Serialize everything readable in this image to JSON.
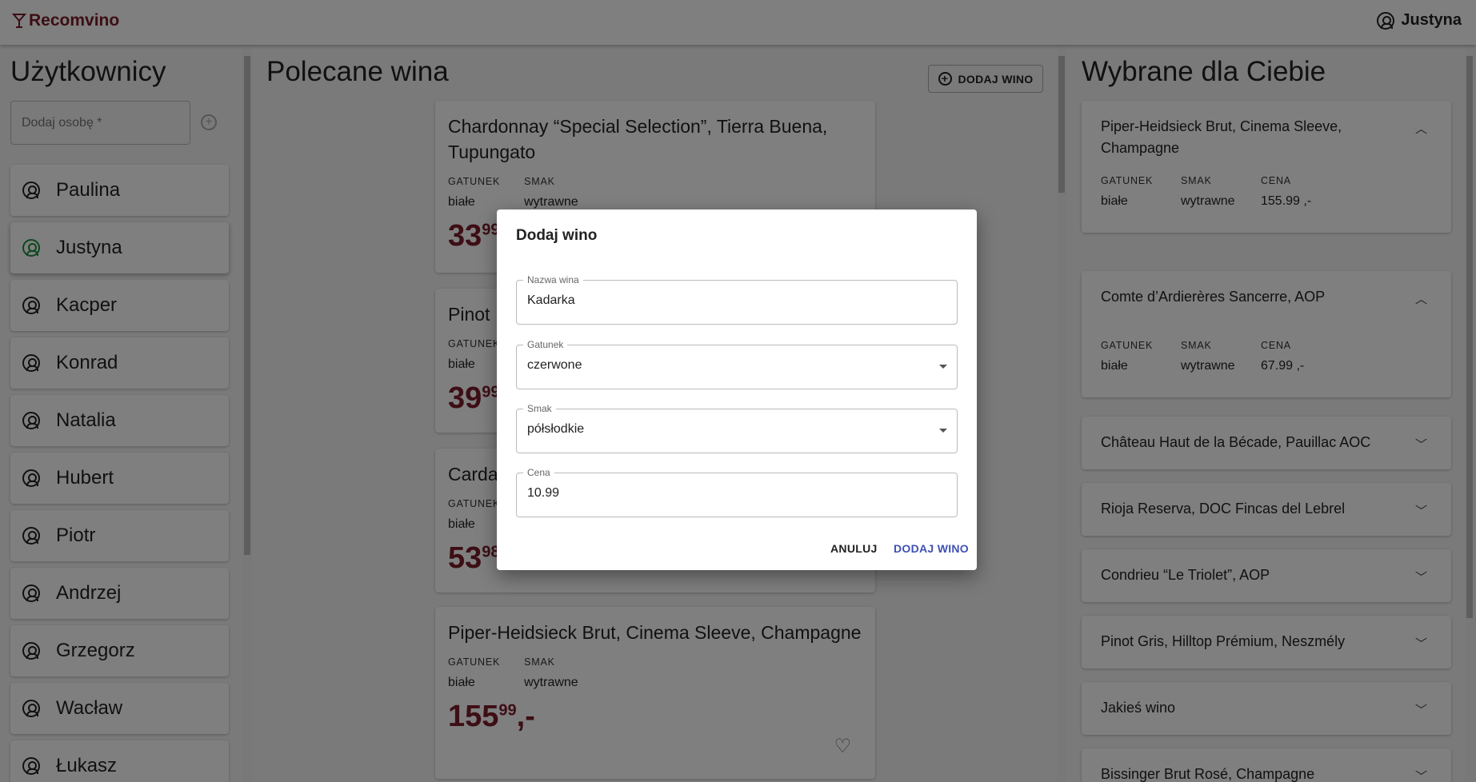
{
  "header": {
    "app_name": "Recomvino",
    "user_name": "Justyna"
  },
  "users": {
    "title": "Użytkownicy",
    "add_placeholder": "Dodaj osobę *",
    "items": [
      "Paulina",
      "Justyna",
      "Kacper",
      "Konrad",
      "Natalia",
      "Hubert",
      "Piotr",
      "Andrzej",
      "Grzegorz",
      "Wacław",
      "Łukasz"
    ],
    "active": "Justyna",
    "active_color": "#1e8e3e"
  },
  "recommended": {
    "title": "Polecane wina",
    "add_button": "DODAJ WINO",
    "labels": {
      "type": "GATUNEK",
      "taste": "SMAK"
    },
    "wines": [
      {
        "name": "Chardonnay “Special Selection”, Tierra Buena, Tupungato",
        "type": "białe",
        "taste": "wytrawne",
        "price_int": "33",
        "price_dec": "99",
        "suffix": ",-"
      },
      {
        "name": "Pinot",
        "type": "białe",
        "price_int": "39",
        "price_dec": "99"
      },
      {
        "name": "Carda",
        "type": "białe",
        "price_int": "53",
        "price_dec": "98"
      },
      {
        "name": "Piper-Heidsieck Brut, Cinema Sleeve, Champagne",
        "type": "białe",
        "taste": "wytrawne",
        "price_int": "155",
        "price_dec": "99",
        "suffix": ",-"
      }
    ]
  },
  "for_you": {
    "title": "Wybrane dla Ciebie",
    "labels": {
      "type": "GATUNEK",
      "taste": "SMAK",
      "price": "CENA"
    },
    "items": [
      {
        "name": "Piper-Heidsieck Brut, Cinema Sleeve, Champagne",
        "expanded": true,
        "type": "białe",
        "taste": "wytrawne",
        "price": "155.99 ,-"
      },
      {
        "name": "Comte d’Ardierères Sancerre, AOP",
        "expanded": true,
        "type": "białe",
        "taste": "wytrawne",
        "price": "67.99 ,-"
      },
      {
        "name": "Château Haut de la Bécade, Pauillac AOC",
        "expanded": false
      },
      {
        "name": "Rioja Reserva, DOC Fincas del Lebrel",
        "expanded": false
      },
      {
        "name": "Condrieu “Le Triolet”, AOP",
        "expanded": false
      },
      {
        "name": "Pinot Gris, Hilltop Prémium, Neszmély",
        "expanded": false
      },
      {
        "name": "Jakieś wino",
        "expanded": false
      },
      {
        "name": "Bissinger Brut Rosé, Champagne",
        "expanded": false
      }
    ]
  },
  "dialog": {
    "title": "Dodaj wino",
    "name_label": "Nazwa wina",
    "name_value": "Kadarka",
    "type_label": "Gatunek",
    "type_value": "czerwone",
    "taste_label": "Smak",
    "taste_value": "półsłodkie",
    "price_label": "Cena",
    "price_value": "10.99",
    "cancel": "ANULUJ",
    "submit": "DODAJ WINO",
    "submit_color": "#3f51b5"
  }
}
